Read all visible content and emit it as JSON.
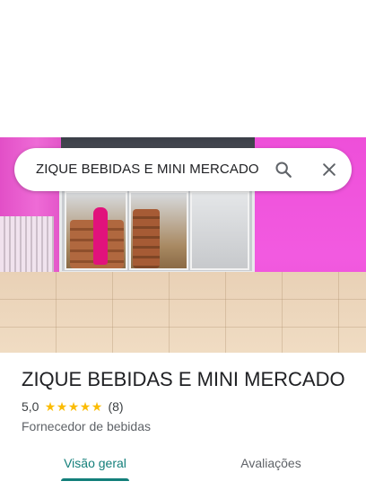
{
  "search": {
    "query": "ZIQUE BEBIDAS E MINI MERCADO",
    "search_icon": "search-icon",
    "close_icon": "close-icon"
  },
  "place": {
    "name": "ZIQUE BEBIDAS E MINI MERCADO",
    "rating": "5,0",
    "stars": 5,
    "review_count": "(8)",
    "category": "Fornecedor de bebidas",
    "photo": "storefront-photo"
  },
  "tabs": [
    {
      "label": "Visão geral",
      "active": true
    },
    {
      "label": "Avaliações",
      "active": false
    }
  ],
  "colors": {
    "accent": "#137f7a",
    "star": "#fbbc04",
    "text_primary": "#202124",
    "text_secondary": "#5f6368"
  }
}
